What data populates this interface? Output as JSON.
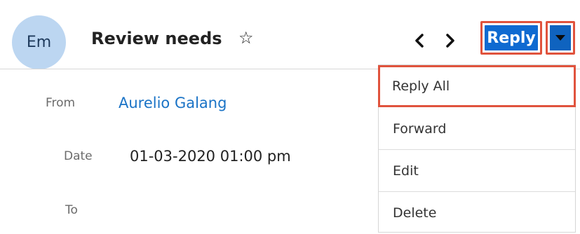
{
  "record": {
    "avatar_initials": "Em",
    "title": "Review needs"
  },
  "icons": {
    "star": "star-outline-icon",
    "prev": "chevron-left-icon",
    "next": "chevron-right-icon",
    "caret": "caret-down-icon"
  },
  "actions": {
    "reply_label": "Reply"
  },
  "fields": {
    "from_label": "From",
    "from_value": "Aurelio Galang",
    "date_label": "Date",
    "date_value": "01-03-2020 01:00 pm",
    "to_label": "To"
  },
  "dropdown": {
    "items": [
      {
        "label": "Reply All"
      },
      {
        "label": "Forward"
      },
      {
        "label": "Edit"
      },
      {
        "label": "Delete"
      }
    ]
  },
  "colors": {
    "primary": "#0f6ad1",
    "highlight": "#e0533d",
    "link": "#1a73c6",
    "avatar_bg": "#bcd6f1"
  }
}
